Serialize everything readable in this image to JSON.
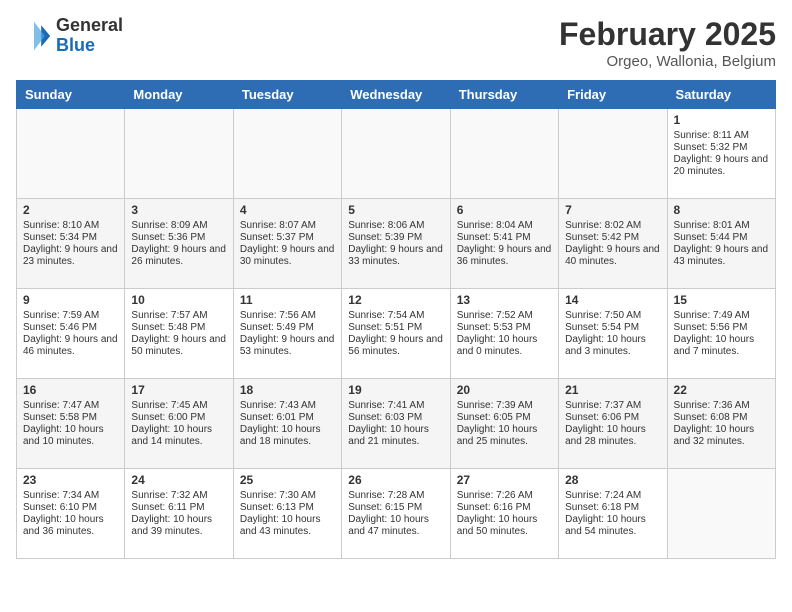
{
  "header": {
    "logo_general": "General",
    "logo_blue": "Blue",
    "month_year": "February 2025",
    "location": "Orgeo, Wallonia, Belgium"
  },
  "weekdays": [
    "Sunday",
    "Monday",
    "Tuesday",
    "Wednesday",
    "Thursday",
    "Friday",
    "Saturday"
  ],
  "weeks": [
    [
      {
        "day": "",
        "info": ""
      },
      {
        "day": "",
        "info": ""
      },
      {
        "day": "",
        "info": ""
      },
      {
        "day": "",
        "info": ""
      },
      {
        "day": "",
        "info": ""
      },
      {
        "day": "",
        "info": ""
      },
      {
        "day": "1",
        "info": "Sunrise: 8:11 AM\nSunset: 5:32 PM\nDaylight: 9 hours and 20 minutes."
      }
    ],
    [
      {
        "day": "2",
        "info": "Sunrise: 8:10 AM\nSunset: 5:34 PM\nDaylight: 9 hours and 23 minutes."
      },
      {
        "day": "3",
        "info": "Sunrise: 8:09 AM\nSunset: 5:36 PM\nDaylight: 9 hours and 26 minutes."
      },
      {
        "day": "4",
        "info": "Sunrise: 8:07 AM\nSunset: 5:37 PM\nDaylight: 9 hours and 30 minutes."
      },
      {
        "day": "5",
        "info": "Sunrise: 8:06 AM\nSunset: 5:39 PM\nDaylight: 9 hours and 33 minutes."
      },
      {
        "day": "6",
        "info": "Sunrise: 8:04 AM\nSunset: 5:41 PM\nDaylight: 9 hours and 36 minutes."
      },
      {
        "day": "7",
        "info": "Sunrise: 8:02 AM\nSunset: 5:42 PM\nDaylight: 9 hours and 40 minutes."
      },
      {
        "day": "8",
        "info": "Sunrise: 8:01 AM\nSunset: 5:44 PM\nDaylight: 9 hours and 43 minutes."
      }
    ],
    [
      {
        "day": "9",
        "info": "Sunrise: 7:59 AM\nSunset: 5:46 PM\nDaylight: 9 hours and 46 minutes."
      },
      {
        "day": "10",
        "info": "Sunrise: 7:57 AM\nSunset: 5:48 PM\nDaylight: 9 hours and 50 minutes."
      },
      {
        "day": "11",
        "info": "Sunrise: 7:56 AM\nSunset: 5:49 PM\nDaylight: 9 hours and 53 minutes."
      },
      {
        "day": "12",
        "info": "Sunrise: 7:54 AM\nSunset: 5:51 PM\nDaylight: 9 hours and 56 minutes."
      },
      {
        "day": "13",
        "info": "Sunrise: 7:52 AM\nSunset: 5:53 PM\nDaylight: 10 hours and 0 minutes."
      },
      {
        "day": "14",
        "info": "Sunrise: 7:50 AM\nSunset: 5:54 PM\nDaylight: 10 hours and 3 minutes."
      },
      {
        "day": "15",
        "info": "Sunrise: 7:49 AM\nSunset: 5:56 PM\nDaylight: 10 hours and 7 minutes."
      }
    ],
    [
      {
        "day": "16",
        "info": "Sunrise: 7:47 AM\nSunset: 5:58 PM\nDaylight: 10 hours and 10 minutes."
      },
      {
        "day": "17",
        "info": "Sunrise: 7:45 AM\nSunset: 6:00 PM\nDaylight: 10 hours and 14 minutes."
      },
      {
        "day": "18",
        "info": "Sunrise: 7:43 AM\nSunset: 6:01 PM\nDaylight: 10 hours and 18 minutes."
      },
      {
        "day": "19",
        "info": "Sunrise: 7:41 AM\nSunset: 6:03 PM\nDaylight: 10 hours and 21 minutes."
      },
      {
        "day": "20",
        "info": "Sunrise: 7:39 AM\nSunset: 6:05 PM\nDaylight: 10 hours and 25 minutes."
      },
      {
        "day": "21",
        "info": "Sunrise: 7:37 AM\nSunset: 6:06 PM\nDaylight: 10 hours and 28 minutes."
      },
      {
        "day": "22",
        "info": "Sunrise: 7:36 AM\nSunset: 6:08 PM\nDaylight: 10 hours and 32 minutes."
      }
    ],
    [
      {
        "day": "23",
        "info": "Sunrise: 7:34 AM\nSunset: 6:10 PM\nDaylight: 10 hours and 36 minutes."
      },
      {
        "day": "24",
        "info": "Sunrise: 7:32 AM\nSunset: 6:11 PM\nDaylight: 10 hours and 39 minutes."
      },
      {
        "day": "25",
        "info": "Sunrise: 7:30 AM\nSunset: 6:13 PM\nDaylight: 10 hours and 43 minutes."
      },
      {
        "day": "26",
        "info": "Sunrise: 7:28 AM\nSunset: 6:15 PM\nDaylight: 10 hours and 47 minutes."
      },
      {
        "day": "27",
        "info": "Sunrise: 7:26 AM\nSunset: 6:16 PM\nDaylight: 10 hours and 50 minutes."
      },
      {
        "day": "28",
        "info": "Sunrise: 7:24 AM\nSunset: 6:18 PM\nDaylight: 10 hours and 54 minutes."
      },
      {
        "day": "",
        "info": ""
      }
    ]
  ]
}
